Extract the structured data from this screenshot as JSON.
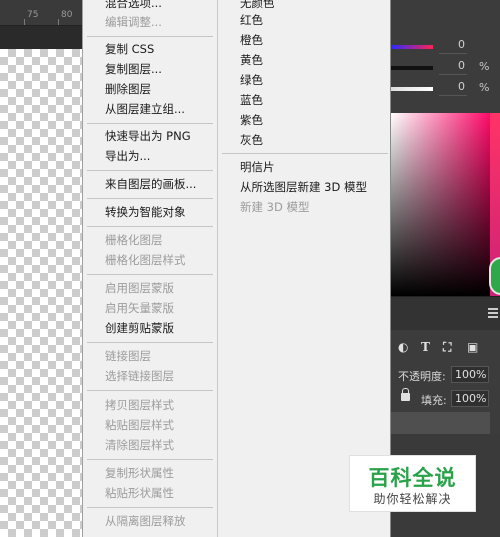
{
  "ruler": {
    "marks": [
      "75",
      "80"
    ]
  },
  "context_menu": {
    "left_column": [
      {
        "label": "混合选项...",
        "enabled": true
      },
      {
        "label": "编辑调整...",
        "enabled": false
      },
      {
        "label": "复制 CSS",
        "enabled": true
      },
      {
        "label": "复制图层...",
        "enabled": true
      },
      {
        "label": "删除图层",
        "enabled": true
      },
      {
        "label": "从图层建立组...",
        "enabled": true
      },
      {
        "label": "快速导出为 PNG",
        "enabled": true
      },
      {
        "label": "导出为...",
        "enabled": true
      },
      {
        "label": "来自图层的画板...",
        "enabled": true
      },
      {
        "label": "转换为智能对象",
        "enabled": true
      },
      {
        "label": "栅格化图层",
        "enabled": false
      },
      {
        "label": "栅格化图层样式",
        "enabled": false
      },
      {
        "label": "启用图层蒙版",
        "enabled": false
      },
      {
        "label": "启用矢量蒙版",
        "enabled": false
      },
      {
        "label": "创建剪贴蒙版",
        "enabled": true
      },
      {
        "label": "链接图层",
        "enabled": false
      },
      {
        "label": "选择链接图层",
        "enabled": false
      },
      {
        "label": "拷贝图层样式",
        "enabled": false
      },
      {
        "label": "粘贴图层样式",
        "enabled": false
      },
      {
        "label": "清除图层样式",
        "enabled": false
      },
      {
        "label": "复制形状属性",
        "enabled": false
      },
      {
        "label": "粘贴形状属性",
        "enabled": false
      },
      {
        "label": "从隔离图层释放",
        "enabled": false
      }
    ],
    "right_column": [
      {
        "label": "无颜色",
        "enabled": true
      },
      {
        "label": "红色",
        "enabled": true
      },
      {
        "label": "橙色",
        "enabled": true
      },
      {
        "label": "黄色",
        "enabled": true
      },
      {
        "label": "绿色",
        "enabled": true
      },
      {
        "label": "蓝色",
        "enabled": true
      },
      {
        "label": "紫色",
        "enabled": true
      },
      {
        "label": "灰色",
        "enabled": true
      },
      {
        "label": "明信片",
        "enabled": true
      },
      {
        "label": "从所选图层新建 3D 模型",
        "enabled": true
      },
      {
        "label": "新建 3D 模型",
        "enabled": false
      }
    ]
  },
  "color_panel": {
    "sliders": [
      {
        "value": "0",
        "unit": "",
        "color": "#2a2aff"
      },
      {
        "value": "0",
        "unit": "%",
        "color": "#111111"
      },
      {
        "value": "0",
        "unit": "%",
        "color": "#dddddd"
      }
    ],
    "gradient_color": "#ff0a6a"
  },
  "layers_panel": {
    "opacity_label": "不透明度:",
    "opacity_value": "100%",
    "fill_label": "填充:",
    "fill_value": "100%"
  },
  "watermark": {
    "title": "百科全说",
    "subtitle": "助你轻松解决"
  }
}
